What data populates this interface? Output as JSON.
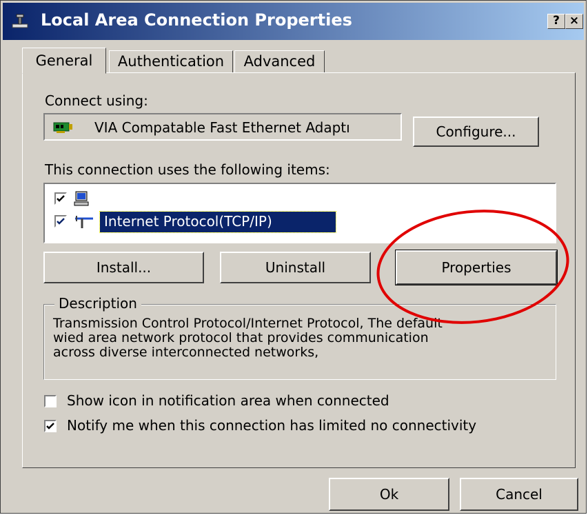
{
  "window": {
    "title": "Local Area Connection Properties",
    "help_label": "?",
    "close_label": "×",
    "title_icon": "network-connection-icon",
    "colors": {
      "title_start": "#0a246a",
      "title_end": "#a6caf0",
      "face": "#d4d0c8",
      "highlight": "#0a246a",
      "annotation": "#e00000"
    }
  },
  "tabs": [
    {
      "label": "General",
      "active": true
    },
    {
      "label": "Authentication",
      "active": false
    },
    {
      "label": "Advanced",
      "active": false
    }
  ],
  "connect_using": {
    "label": "Connect using:",
    "adapter_icon": "network-card-icon",
    "adapter_name": "VIA Compatable Fast Ethernet Adaptı",
    "configure_label": "Configure..."
  },
  "items": {
    "label": "This connection uses the following items:",
    "list": [
      {
        "checked": true,
        "icon": "computer-icon",
        "label": "",
        "selected": false
      },
      {
        "checked": true,
        "icon": "network-protocol-icon",
        "label": "Internet Protocol(TCP/IP)",
        "selected": true
      }
    ]
  },
  "buttons": {
    "install": "Install...",
    "uninstall": "Uninstall",
    "properties": "Properties",
    "ok": "Ok",
    "cancel": "Cancel"
  },
  "description": {
    "legend": "Description",
    "text_lines": [
      "Transmission Control Protocol/Internet Protocol, The default",
      "wied area network protocol that provides communication",
      "across diverse interconnected networks,"
    ]
  },
  "options": [
    {
      "label": "Show icon in notification area when connected",
      "checked": false
    },
    {
      "label": "Notify me when this connection has limited no connectivity",
      "checked": true
    }
  ]
}
